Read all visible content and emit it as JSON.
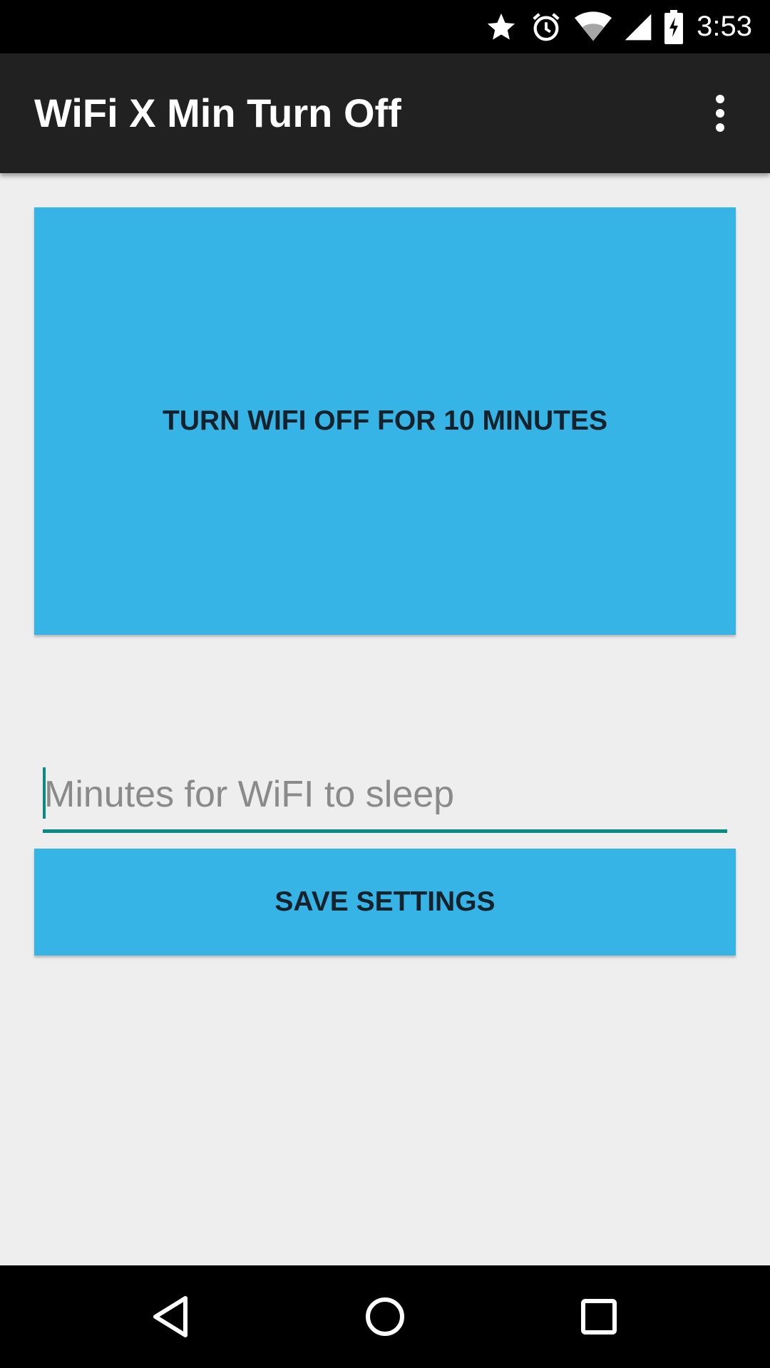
{
  "status_bar": {
    "time": "3:53",
    "icons": [
      "star-icon",
      "alarm-icon",
      "wifi-icon",
      "cell-signal-icon",
      "battery-charging-icon"
    ]
  },
  "app_bar": {
    "title": "WiFi X Min Turn Off",
    "menu_icon": "overflow-menu-icon"
  },
  "main": {
    "turn_off_button_label": "TURN WIFI OFF FOR 10 MINUTES",
    "minutes_input": {
      "value": "",
      "placeholder": "Minutes for WiFI to sleep"
    },
    "save_button_label": "SAVE SETTINGS"
  },
  "nav_bar": {
    "icons": [
      "back-icon",
      "home-icon",
      "recents-icon"
    ]
  },
  "colors": {
    "status_bar": "#000000",
    "app_bar": "#212121",
    "background": "#eeeeee",
    "button": "#35b4e5",
    "button_text": "#16222b",
    "accent": "#0a8a80"
  }
}
